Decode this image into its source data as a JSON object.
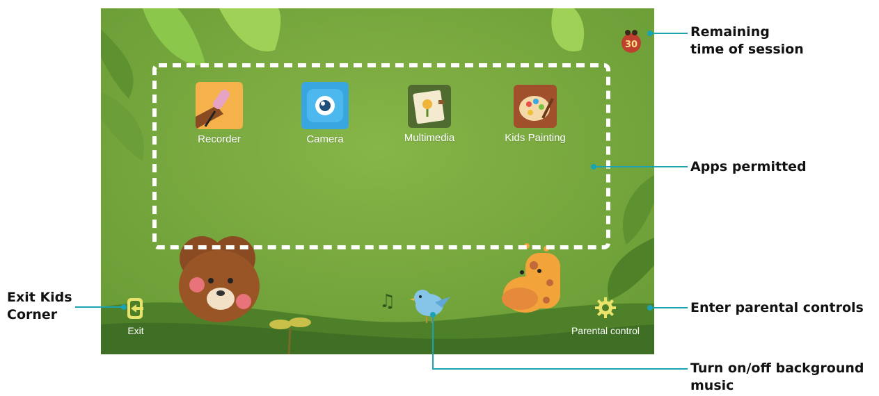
{
  "apps": [
    {
      "label": "Recorder",
      "icon": "microphone-icon",
      "color": "#f6b24a"
    },
    {
      "label": "Camera",
      "icon": "camera-icon",
      "color": "#3aa6e0"
    },
    {
      "label": "Multimedia",
      "icon": "photo-album-icon",
      "color": "#4f6b2f"
    },
    {
      "label": "Kids Painting",
      "icon": "palette-icon",
      "color": "#a0502b"
    }
  ],
  "bottom_bar": {
    "exit_label": "Exit",
    "parental_label": "Parental control"
  },
  "timer": {
    "value": "30"
  },
  "callouts": {
    "remaining_time": [
      "Remaining",
      "time of session"
    ],
    "apps_permitted": "Apps permitted",
    "exit_kids_corner": [
      "Exit Kids",
      "Corner"
    ],
    "enter_parental": "Enter parental controls",
    "background_music": [
      "Turn on/off background",
      "music"
    ]
  },
  "colors": {
    "background": "#7cac3f",
    "callout_line": "#1aa3b5",
    "hill_dark": "#3f6f24"
  }
}
